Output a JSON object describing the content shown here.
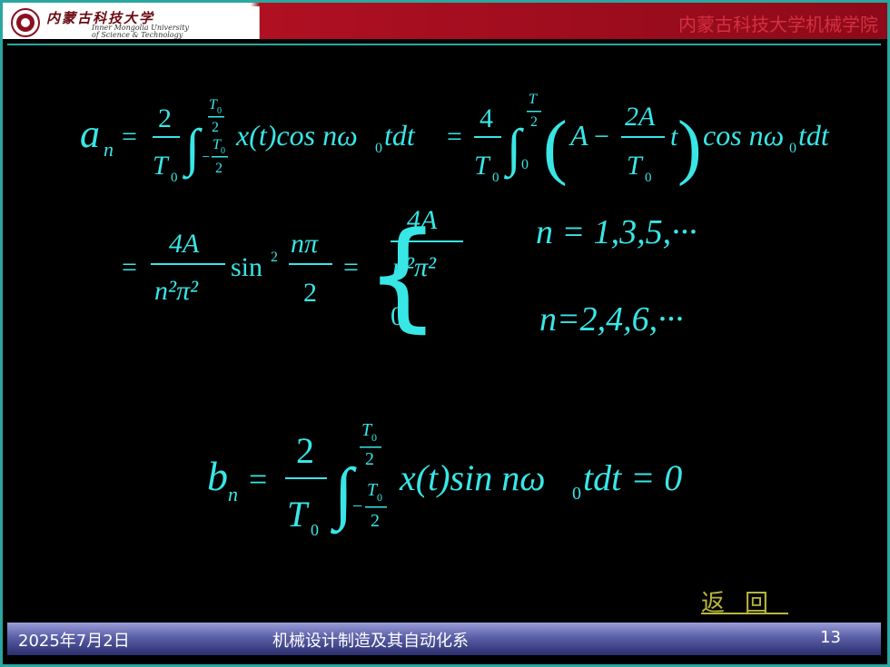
{
  "header": {
    "logo_cn": "内蒙古科技大学",
    "logo_en_line1": "Inner Mongolia University",
    "logo_en_line2": "of Science & Technology",
    "title": "内蒙古科技大学机械学院"
  },
  "formulas": {
    "an_line1": {
      "lhs": "a",
      "lhs_sub": "n",
      "coef1_num": "2",
      "coef1_den": "T",
      "bounds1_upper_num": "T",
      "bounds1_upper_den": "2",
      "bounds1_lower_num": "T",
      "bounds1_lower_den": "2",
      "integrand1": "x(t)cos nω",
      "integrand1_end": "tdt",
      "coef2_num": "4",
      "coef2_den": "T",
      "bounds2_upper_num": "T",
      "bounds2_upper_den": "2",
      "bounds2_lower": "0",
      "paren_A": "A",
      "paren_frac_num": "2A",
      "paren_frac_den": "T",
      "paren_t": "t",
      "tail": "cos nω",
      "tail_end": "tdt"
    },
    "an_line2": {
      "frac_num": "4A",
      "frac_den": "n²π²",
      "sin": "sin",
      "sin_pow": "2",
      "arg_num": "nπ",
      "arg_den": "2",
      "case1_num": "4A",
      "case1_den": "n²π²",
      "case2": "0",
      "cond1": "n = 1,3,5,···",
      "cond2": "n=2,4,6,···"
    },
    "bn": {
      "lhs": "b",
      "lhs_sub": "n",
      "coef_num": "2",
      "coef_den": "T",
      "integrand": "x(t)sin nω",
      "integrand_end": "tdt = 0"
    }
  },
  "return_link": "返回",
  "footer": {
    "date": "2025年7月2日",
    "department": "机械设计制造及其自动化系",
    "page": "13"
  },
  "colors": {
    "formula": "#39e6e6",
    "border": "#2aa7a0",
    "header_red": "#b01022",
    "return": "#b9b63b"
  }
}
